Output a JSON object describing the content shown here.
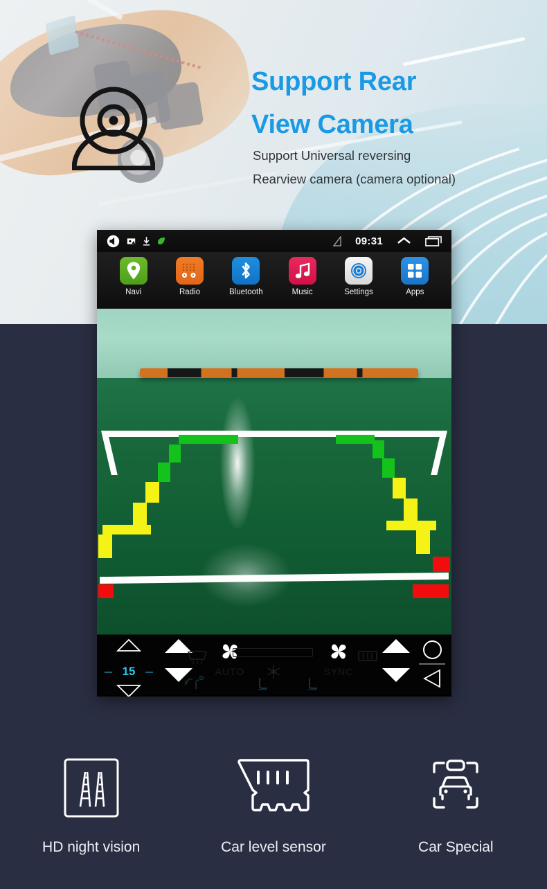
{
  "hero": {
    "headline_line1": "Support Rear",
    "headline_line2": "View Camera",
    "sub_line1": "Support Universal reversing",
    "sub_line2": "Rearview camera (camera optional)",
    "headline_color": "#1a9ae4",
    "camera_icon": "webcam-icon"
  },
  "head_unit": {
    "status_bar": {
      "time": "09:31",
      "left_icons": [
        "volume-icon",
        "screenshot-icon",
        "download-icon",
        "leaf-icon"
      ],
      "right_icons": [
        "no-signal-icon",
        "chevron-up-icon",
        "recents-icon"
      ]
    },
    "apps": [
      {
        "label": "Navi",
        "icon": "map-pin-icon",
        "color": "#5faf22"
      },
      {
        "label": "Radio",
        "icon": "radio-icon",
        "color": "#e96f1e"
      },
      {
        "label": "Bluetooth",
        "icon": "bluetooth-icon",
        "color": "#1680d4"
      },
      {
        "label": "Music",
        "icon": "music-note-icon",
        "color": "#e01e53"
      },
      {
        "label": "Settings",
        "icon": "gear-icon",
        "color": "#e8e8e8"
      },
      {
        "label": "Apps",
        "icon": "grid-icon",
        "color": "#2484da"
      }
    ],
    "camera_view": {
      "description": "rear-view camera feed of green floor with white parking lines",
      "guide_colors": {
        "near": "#14c21c",
        "mid": "#f5f215",
        "far": "#f10d0d"
      }
    },
    "climate": {
      "temperature": "15",
      "temp_color": "#2fc3e8",
      "auto_label": "AUTO",
      "sync_label": "SYNC",
      "icons": [
        "fan-icon",
        "defrost-front-icon",
        "defrost-rear-icon",
        "snowflake-icon",
        "seat-heater-icon",
        "rear-window-icon"
      ],
      "nav_icons": [
        "home-circle-icon",
        "menu-line-icon",
        "back-triangle-icon"
      ]
    }
  },
  "features": [
    {
      "label": "HD night vision",
      "icon": "night-vision-guide-lines-icon"
    },
    {
      "label": "Car level sensor",
      "icon": "parking-sensor-icon"
    },
    {
      "label": "Car Special",
      "icon": "car-fit-icon"
    }
  ],
  "theme": {
    "background": "#2a2e42",
    "hero_background": "#e7ecee",
    "accent": "#1a9ae4"
  }
}
